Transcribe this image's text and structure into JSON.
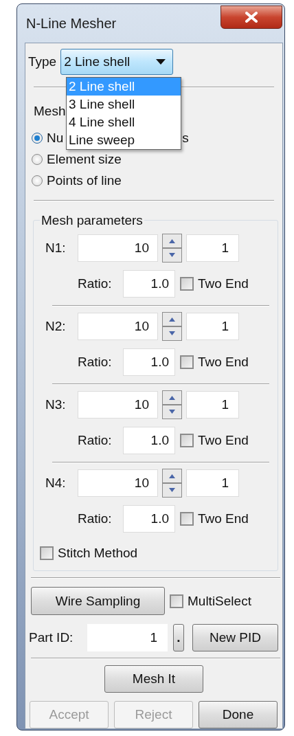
{
  "window": {
    "title": "N-Line Mesher"
  },
  "type_field": {
    "label": "Type",
    "value": "2 Line shell",
    "expanded": true,
    "options": [
      {
        "label": "2 Line shell",
        "selected": true
      },
      {
        "label": "3 Line shell",
        "selected": false
      },
      {
        "label": "4 Line shell",
        "selected": false
      },
      {
        "label": "Line sweep",
        "selected": false
      }
    ]
  },
  "mesh_group": {
    "label": "Mesh",
    "options": [
      {
        "label": "Nu",
        "label_tail": "s",
        "selected": true
      },
      {
        "label": "Element size",
        "selected": false
      },
      {
        "label": "Points of line",
        "selected": false
      }
    ]
  },
  "mesh_parameters": {
    "title": "Mesh parameters",
    "lines": [
      {
        "label": "N1:",
        "count": "10",
        "step": "1",
        "ratio_label": "Ratio:",
        "ratio": "1.0",
        "two_end": {
          "label": "Two End",
          "checked": false
        }
      },
      {
        "label": "N2:",
        "count": "10",
        "step": "1",
        "ratio_label": "Ratio:",
        "ratio": "1.0",
        "two_end": {
          "label": "Two End",
          "checked": false
        }
      },
      {
        "label": "N3:",
        "count": "10",
        "step": "1",
        "ratio_label": "Ratio:",
        "ratio": "1.0",
        "two_end": {
          "label": "Two End",
          "checked": false
        }
      },
      {
        "label": "N4:",
        "count": "10",
        "step": "1",
        "ratio_label": "Ratio:",
        "ratio": "1.0",
        "two_end": {
          "label": "Two End",
          "checked": false
        }
      }
    ],
    "stitch_method": {
      "label": "Stitch Method",
      "checked": false
    }
  },
  "wire_sampling": {
    "button": "Wire Sampling",
    "multiselect": {
      "label": "MultiSelect",
      "checked": false
    }
  },
  "part_id": {
    "label": "Part ID:",
    "value": "1",
    "dot_button": ".",
    "new_button": "New PID"
  },
  "mesh_button": "Mesh It",
  "buttons": [
    {
      "label": "Accept",
      "disabled": true
    },
    {
      "label": "Reject",
      "disabled": true
    },
    {
      "label": "Done",
      "disabled": false
    }
  ]
}
